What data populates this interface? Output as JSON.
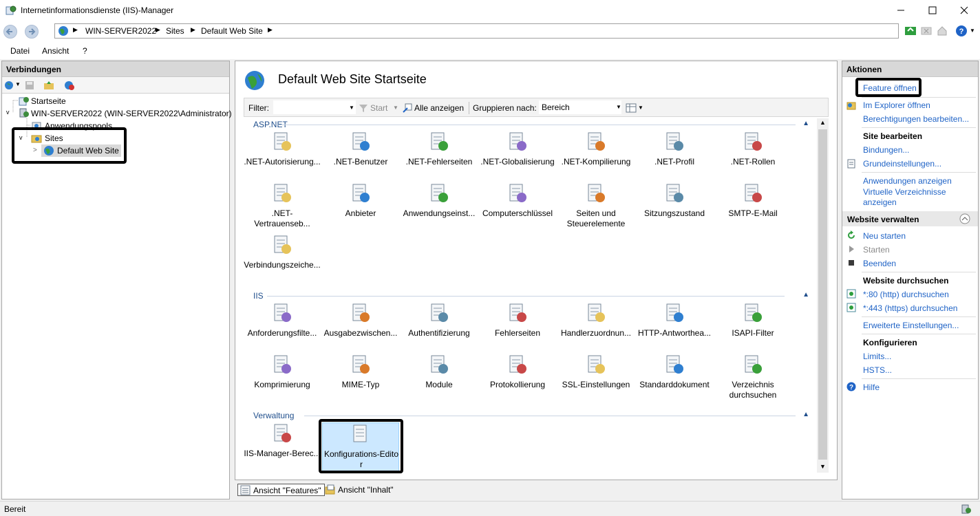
{
  "window": {
    "title": "Internetinformationsdienste (IIS)-Manager"
  },
  "address": {
    "crumbs": [
      "WIN-SERVER2022",
      "Sites",
      "Default Web Site"
    ]
  },
  "menu": [
    "Datei",
    "Ansicht",
    "?"
  ],
  "connections": {
    "title": "Verbindungen",
    "tree": {
      "start": "Startseite",
      "server": "WIN-SERVER2022 (WIN-SERVER2022\\Administrator)",
      "app_pools": "Anwendungspools",
      "sites": "Sites",
      "default_site": "Default Web Site"
    }
  },
  "center": {
    "title": "Default Web Site Startseite",
    "filter_label": "Filter:",
    "start_label": "Start",
    "show_all_label": "Alle anzeigen",
    "group_label": "Gruppieren nach:",
    "group_value": "Bereich",
    "sections": [
      {
        "name": "ASP.NET",
        "items": [
          ".NET-Autorisierung...",
          ".NET-Benutzer",
          ".NET-Fehlerseiten",
          ".NET-Globalisierung",
          ".NET-Kompilierung",
          ".NET-Profil",
          ".NET-Rollen",
          ".NET-Vertrauenseb...",
          "Anbieter",
          "Anwendungseinst...",
          "Computerschlüssel",
          "Seiten und Steuerelemente",
          "Sitzungszustand",
          "SMTP-E-Mail",
          "Verbindungszeiche..."
        ]
      },
      {
        "name": "IIS",
        "items": [
          "Anforderungsfilte...",
          "Ausgabezwischen...",
          "Authentifizierung",
          "Fehlerseiten",
          "Handlerzuordnun...",
          "HTTP-Antworthea...",
          "ISAPI-Filter",
          "Komprimierung",
          "MIME-Typ",
          "Module",
          "Protokollierung",
          "SSL-Einstellungen",
          "Standarddokument",
          "Verzeichnis durchsuchen"
        ]
      },
      {
        "name": "Verwaltung",
        "items": [
          "IIS-Manager-Berec...",
          "Konfigurations-Editor"
        ]
      }
    ],
    "view_tabs": [
      "Ansicht \"Features\"",
      "Ansicht \"Inhalt\""
    ]
  },
  "actions": {
    "title": "Aktionen",
    "feature_open": "Feature öffnen",
    "explorer_open": "Im Explorer öffnen",
    "edit_permissions": "Berechtigungen bearbeiten...",
    "edit_site_head": "Site bearbeiten",
    "bindings": "Bindungen...",
    "basic_settings": "Grundeinstellungen...",
    "show_apps": "Anwendungen anzeigen",
    "virtual_dirs": "Virtuelle Verzeichnisse anzeigen",
    "manage_band": "Website verwalten",
    "restart": "Neu starten",
    "start": "Starten",
    "stop": "Beenden",
    "browse_head": "Website durchsuchen",
    "browse_http": "*:80 (http) durchsuchen",
    "browse_https": "*:443 (https) durchsuchen",
    "advanced": "Erweiterte Einstellungen...",
    "configure_head": "Konfigurieren",
    "limits": "Limits...",
    "hsts": "HSTS...",
    "help": "Hilfe"
  },
  "status": "Bereit",
  "colors": {
    "link": "#1f63c6",
    "selected_bg": "#cce8ff",
    "section": "#1f4e8c"
  }
}
